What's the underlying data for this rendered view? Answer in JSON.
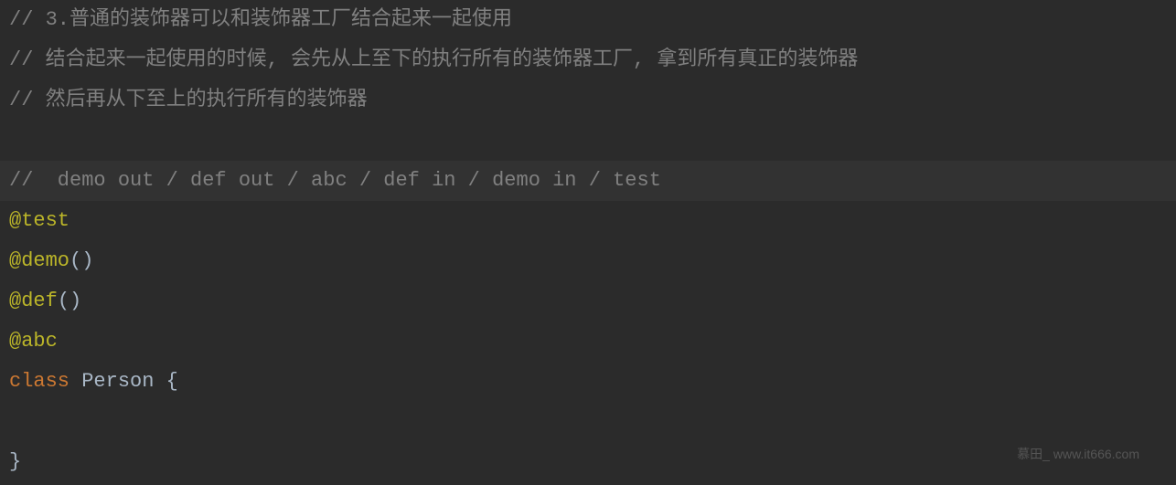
{
  "code": {
    "lines": [
      {
        "type": "comment",
        "text": "// 3.普通的装饰器可以和装饰器工厂结合起来一起使用"
      },
      {
        "type": "comment",
        "text": "// 结合起来一起使用的时候, 会先从上至下的执行所有的装饰器工厂, 拿到所有真正的装饰器"
      },
      {
        "type": "comment-marker",
        "marker": "",
        "text": "// 然后再从下至上的执行所有的装饰器"
      },
      {
        "type": "blank",
        "text": ""
      },
      {
        "type": "comment-highlighted",
        "text": "//  demo out / def out / abc / def in / demo in / test"
      },
      {
        "type": "decorator",
        "at": "@test",
        "call": ""
      },
      {
        "type": "decorator",
        "at": "@demo",
        "call": "()"
      },
      {
        "type": "decorator",
        "at": "@def",
        "call": "()"
      },
      {
        "type": "decorator",
        "at": "@abc",
        "call": ""
      },
      {
        "type": "class-decl",
        "marker": "",
        "keyword": "class",
        "space": " ",
        "name": "Person",
        "rest": " {"
      },
      {
        "type": "blank",
        "text": ""
      },
      {
        "type": "close-brace",
        "marker": "",
        "text": "}"
      }
    ]
  },
  "watermark": "慕田_ www.it666.com"
}
